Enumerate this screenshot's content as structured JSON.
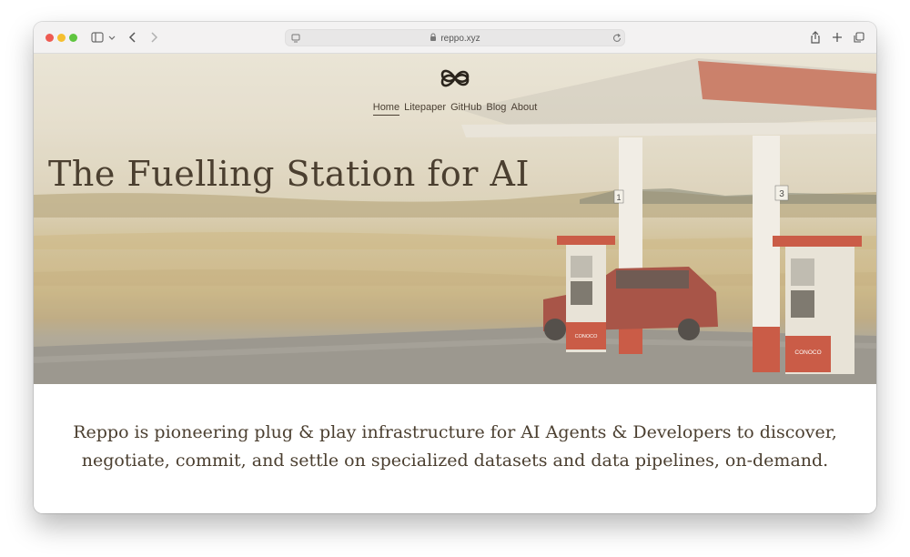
{
  "browser": {
    "url": "reppo.xyz"
  },
  "site": {
    "nav": [
      {
        "label": "Home",
        "active": true
      },
      {
        "label": "Litepaper",
        "active": false
      },
      {
        "label": "GitHub",
        "active": false
      },
      {
        "label": "Blog",
        "active": false
      },
      {
        "label": "About",
        "active": false
      }
    ],
    "hero_title": "The Fuelling Station for AI",
    "tagline": "Reppo is pioneering plug & play infrastructure for AI Agents & Developers to discover, negotiate, commit, and settle on specialized datasets and data pipelines, on-demand.",
    "pump_numbers": [
      "1",
      "3"
    ],
    "pump_brand": "CONOCO"
  },
  "colors": {
    "text": "#4b3f30",
    "canopy": "#c0563f",
    "pump_red": "#c4442e"
  },
  "icons": [
    "sidebar-icon",
    "chevron-down-icon",
    "back-icon",
    "forward-icon",
    "page-icon",
    "lock-icon",
    "reload-icon",
    "share-icon",
    "new-tab-icon",
    "tabs-icon",
    "reppo-logo-icon"
  ]
}
